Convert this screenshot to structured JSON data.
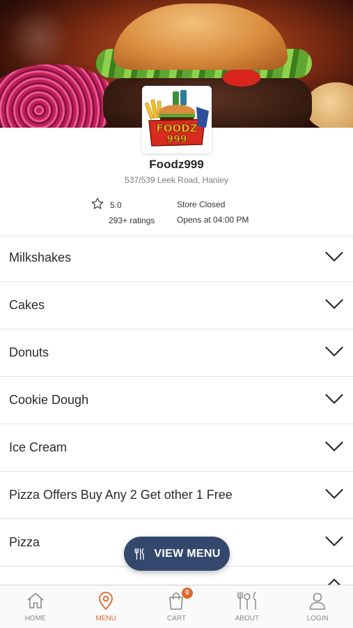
{
  "store": {
    "name": "Foodz999",
    "address": "537/539 Leek Road, Hanley",
    "rating": "5.0",
    "ratings_count": "293+ ratings",
    "status": "Store Closed",
    "opens_at": "Opens at 04:00 PM",
    "logo_text_line1": "FOODZ",
    "logo_text_line2": "999"
  },
  "categories": [
    {
      "label": "Milkshakes",
      "icon": "chevron-down-icon"
    },
    {
      "label": "Cakes",
      "icon": "chevron-down-icon"
    },
    {
      "label": "Donuts",
      "icon": "chevron-down-icon"
    },
    {
      "label": "Cookie Dough",
      "icon": "chevron-down-icon"
    },
    {
      "label": "Ice Cream",
      "icon": "chevron-down-icon"
    },
    {
      "label": "Pizza Offers Buy Any 2 Get other 1 Free",
      "icon": "chevron-down-icon"
    },
    {
      "label": "Pizza",
      "icon": "chevron-down-icon"
    },
    {
      "label": "",
      "icon": "chevron-up-icon"
    }
  ],
  "view_menu": {
    "label": "VIEW MENU",
    "icon": "fork-knife-icon"
  },
  "nav": {
    "items": [
      {
        "label": "HOME",
        "icon": "home-icon"
      },
      {
        "label": "MENU",
        "icon": "location-pin-icon",
        "active": true
      },
      {
        "label": "CART",
        "icon": "shopping-bag-icon"
      },
      {
        "label": "ABOUT",
        "icon": "cutlery-icon"
      },
      {
        "label": "LOGIN",
        "icon": "user-icon"
      }
    ],
    "cart_count": "0"
  },
  "colors": {
    "accent": "#e0652d",
    "button": "#33486c",
    "text": "#2b2b30"
  }
}
